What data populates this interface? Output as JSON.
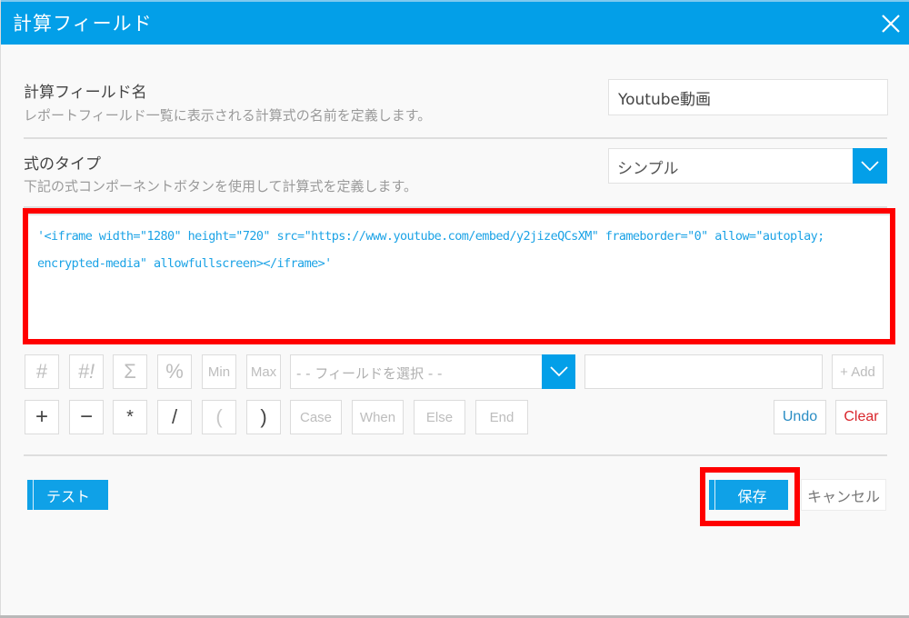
{
  "dialog": {
    "title": "計算フィールド",
    "close_icon": "close-icon",
    "accent_color": "#039fe8"
  },
  "name_row": {
    "label": "計算フィールド名",
    "description": "レポートフィールド一覧に表示される計算式の名前を定義します。",
    "value": "Youtube動画"
  },
  "type_row": {
    "label": "式のタイプ",
    "description": "下記の式コンポーネントボタンを使用して計算式を定義します。",
    "selected": "シンプル",
    "dropdown_icon": "chevron-down-icon"
  },
  "formula": {
    "value": "'<iframe width=\"1280\" height=\"720\" src=\"https://www.youtube.com/embed/y2jizeQCsXM\" frameborder=\"0\" allow=\"autoplay; encrypted-media\" allowfullscreen></iframe>'",
    "highlight_color": "#ff0000"
  },
  "toolbar": {
    "row1": [
      "#",
      "#!",
      "Σ",
      "%",
      "Min",
      "Max"
    ],
    "row2": [
      "+",
      "−",
      "*",
      "/",
      "(",
      ")",
      "Case",
      "When",
      "Else",
      "End"
    ],
    "field_select_placeholder": "- - フィールドを選択 - -",
    "free_input_value": "",
    "add_label": "+ Add",
    "undo_label": "Undo",
    "clear_label": "Clear"
  },
  "footer": {
    "test_label": "テスト",
    "save_label": "保存",
    "cancel_label": "キャンセル"
  }
}
